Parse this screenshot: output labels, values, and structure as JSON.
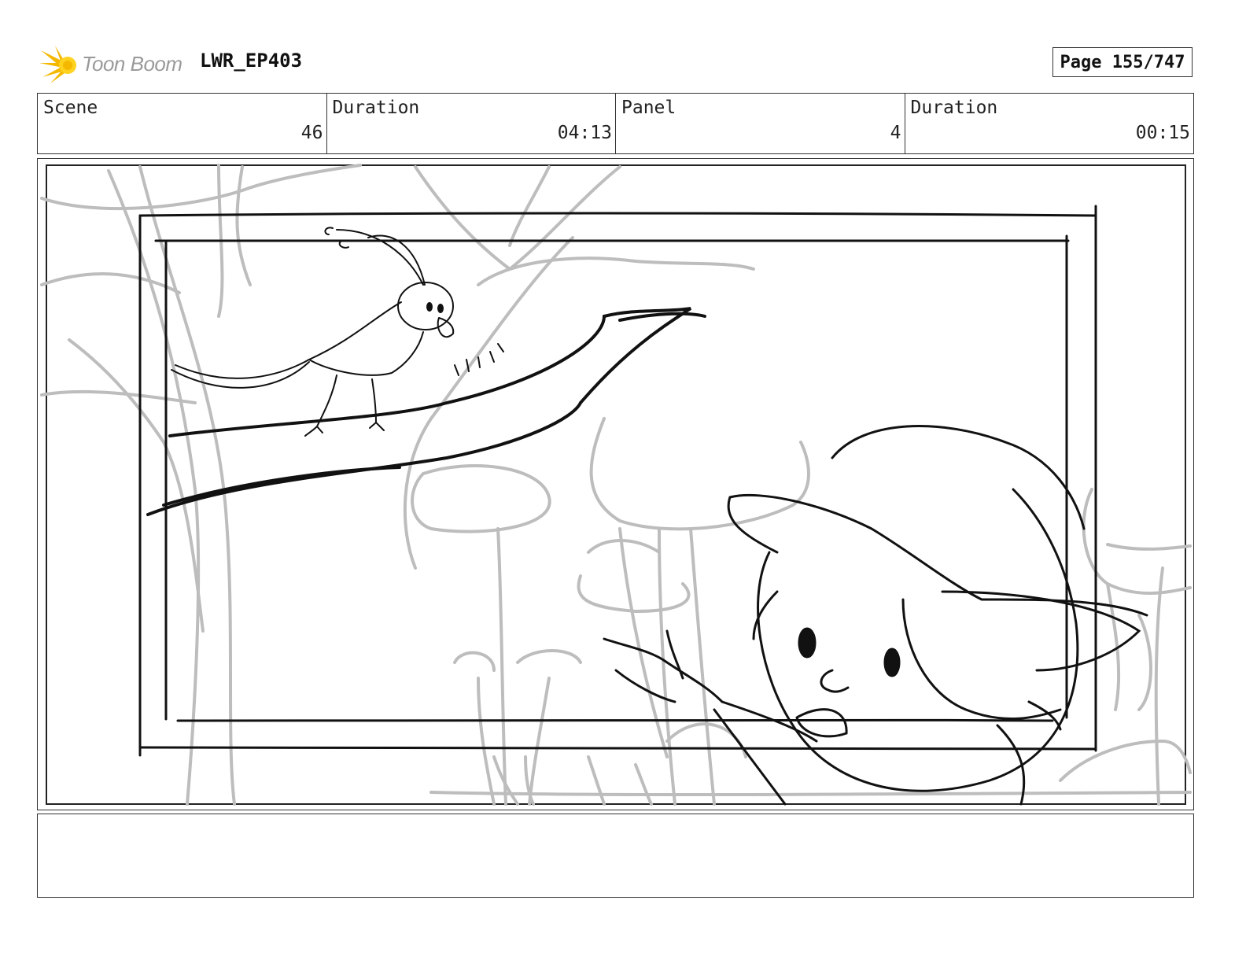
{
  "header": {
    "logo_text": "Toon Boom",
    "project": "LWR_EP403",
    "page": "Page 155/747"
  },
  "info": {
    "scene_label": "Scene",
    "scene_value": "46",
    "scene_duration_label": "Duration",
    "scene_duration_value": "04:13",
    "panel_label": "Panel",
    "panel_value": "4",
    "panel_duration_label": "Duration",
    "panel_duration_value": "00:15"
  },
  "notes": {
    "text": ""
  },
  "colors": {
    "logo_accent": "#f5b800",
    "sketch_dark": "#111111",
    "sketch_rough": "#bbbbbb"
  }
}
